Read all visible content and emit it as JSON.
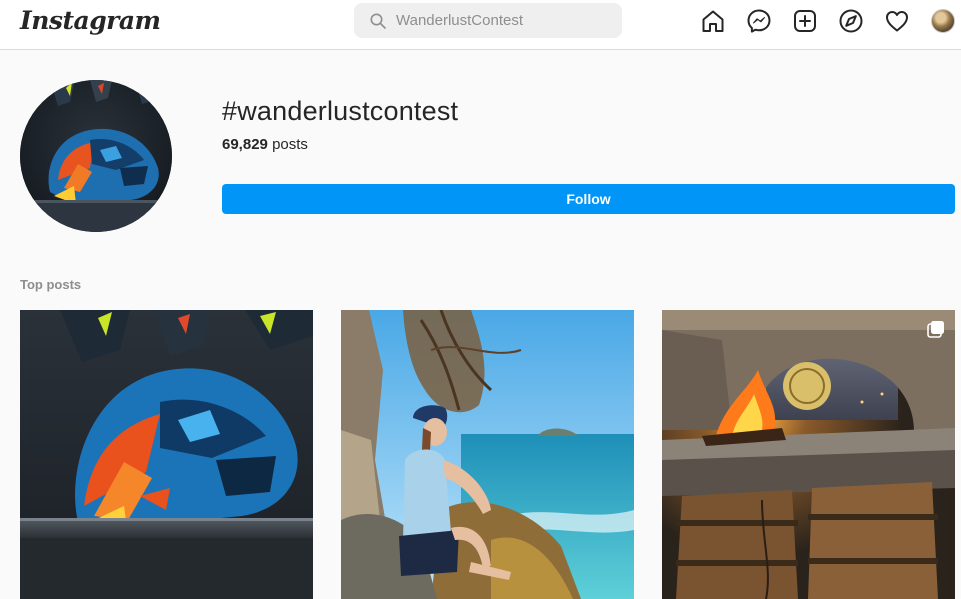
{
  "brand": {
    "logo_text": "Instagram"
  },
  "search": {
    "value": "WanderlustContest",
    "icon": "search-icon"
  },
  "nav": {
    "icons": [
      "home-icon",
      "messenger-icon",
      "new-post-icon",
      "explore-icon",
      "activity-heart-icon",
      "profile-avatar"
    ]
  },
  "hashtag": {
    "title": "#wanderlustcontest",
    "post_count": "69,829",
    "post_count_suffix": "posts",
    "follow_label": "Follow"
  },
  "top_posts": {
    "label": "Top posts",
    "posts": [
      {
        "subject": "motorcycle helmet",
        "multi": false
      },
      {
        "subject": "woman sitting on coastal rocks",
        "multi": false
      },
      {
        "subject": "campfire in stone arch",
        "multi": true
      }
    ]
  },
  "colors": {
    "accent": "#0095f6",
    "background": "#fafafa",
    "text": "#262626",
    "secondary_text": "#8e8e8e"
  }
}
